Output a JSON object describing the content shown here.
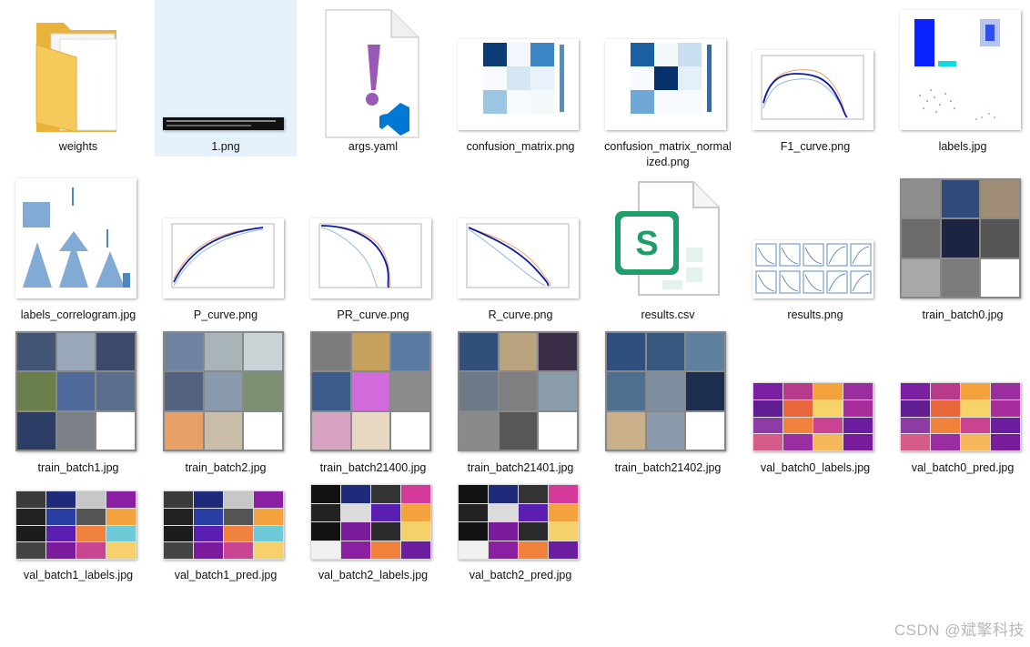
{
  "files": [
    {
      "label": "weights"
    },
    {
      "label": "1.png"
    },
    {
      "label": "args.yaml"
    },
    {
      "label": "confusion_matrix.png"
    },
    {
      "label": "confusion_matrix_normal",
      "label2": "ized.png"
    },
    {
      "label": "F1_curve.png"
    },
    {
      "label": "labels.jpg"
    },
    {
      "label": "labels_correlogram.jpg"
    },
    {
      "label": "P_curve.png"
    },
    {
      "label": "PR_curve.png"
    },
    {
      "label": "R_curve.png"
    },
    {
      "label": "results.csv"
    },
    {
      "label": "results.png"
    },
    {
      "label": "train_batch0.jpg"
    },
    {
      "label": "train_batch1.jpg"
    },
    {
      "label": "train_batch2.jpg"
    },
    {
      "label": "train_batch21400.jpg"
    },
    {
      "label": "train_batch21401.jpg"
    },
    {
      "label": "train_batch21402.jpg"
    },
    {
      "label": "val_batch0_labels.jpg"
    },
    {
      "label": "val_batch0_pred.jpg"
    },
    {
      "label": "val_batch1_labels.jpg"
    },
    {
      "label": "val_batch1_pred.jpg"
    },
    {
      "label": "val_batch2_labels.jpg"
    },
    {
      "label": "val_batch2_pred.jpg"
    }
  ],
  "watermark": "CSDN @斌擎科技",
  "colors": {
    "selection": "#e5f1fb",
    "folder": "#f5c44f",
    "excel_green": "#1f9d6b",
    "vscode_purple": "#9b59b6",
    "vscode_blue": "#0078d4"
  }
}
